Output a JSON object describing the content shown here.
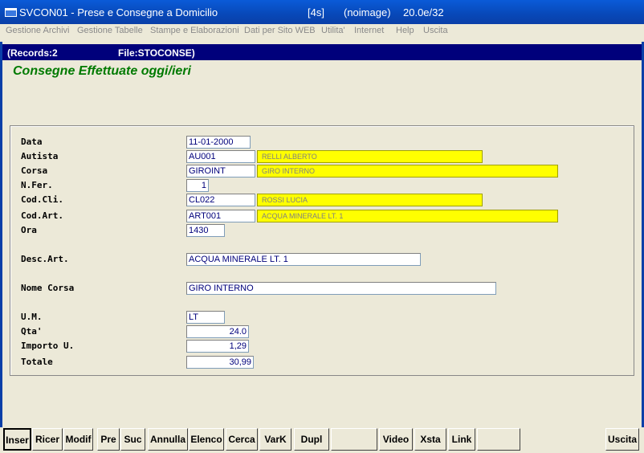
{
  "window": {
    "title": "SVCON01 - Prese e Consegne a Domicilio",
    "counter": "[4s]",
    "image": "(noimage)",
    "version": "20.0e/32"
  },
  "menu": [
    "Gestione Archivi",
    "Gestione Tabelle",
    "Stampe e Elaborazioni",
    "Dati per Sito WEB",
    "Utilita'",
    "Internet",
    "Help",
    "Uscita"
  ],
  "status": {
    "records": "(Records:2",
    "file": "File:STOCONSE)"
  },
  "form": {
    "title": "Consegne Effettuate oggi/ieri",
    "fields": {
      "data": {
        "label": "Data",
        "value": "11-01-2000"
      },
      "autista": {
        "label": "Autista",
        "value": "AU001",
        "desc": "RELLI ALBERTO"
      },
      "corsa": {
        "label": "Corsa",
        "value": "GIROINT",
        "desc": "GIRO INTERNO"
      },
      "nfer": {
        "label": "N.Fer.",
        "value": "1"
      },
      "codcli": {
        "label": "Cod.Cli.",
        "value": "CL022",
        "desc": "ROSSI LUCIA"
      },
      "codart": {
        "label": "Cod.Art.",
        "value": "ART001",
        "desc": "ACQUA MINERALE LT. 1"
      },
      "ora": {
        "label": "Ora",
        "value": "1430"
      },
      "descart": {
        "label": "Desc.Art.",
        "value": "ACQUA MINERALE LT. 1"
      },
      "nomecorsa": {
        "label": "Nome Corsa",
        "value": "GIRO INTERNO"
      },
      "um": {
        "label": "U.M.",
        "value": "LT"
      },
      "qta": {
        "label": "Qta'",
        "value": "24.0"
      },
      "importo": {
        "label": "Importo U.",
        "value": "1,29"
      },
      "totale": {
        "label": "Totale",
        "value": "30,99"
      }
    }
  },
  "toolbar": [
    "Inser",
    "Ricer",
    "Modif",
    "Pre",
    "Suc",
    "Annulla",
    "Elenco",
    "Cerca",
    "VarK",
    "Dupl",
    "",
    "Video",
    "Xsta",
    "Link",
    "",
    "Uscita"
  ],
  "colors": {
    "title_green": "#007a00",
    "desc_yellow": "#ffff00",
    "status_navy": "#00007b",
    "titlebar_blue": "#0a5bd8"
  }
}
